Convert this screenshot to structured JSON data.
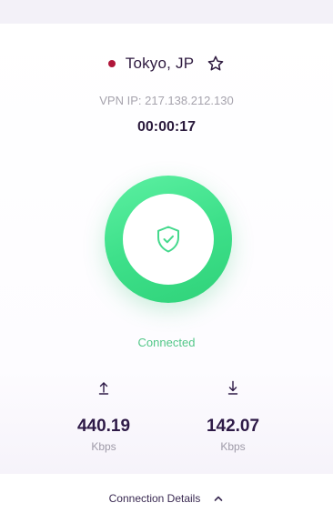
{
  "location": {
    "name": "Tokyo, JP",
    "status_dot_color": "#b0163a"
  },
  "connection": {
    "vpn_ip": "VPN IP: 217.138.212.130",
    "timer": "00:00:17",
    "status": "Connected",
    "status_color": "#52c788",
    "toggle_color": "#3ee08a"
  },
  "stats": {
    "upload": {
      "icon": "upload-arrow-icon",
      "value": "440.19",
      "unit": "Kbps"
    },
    "download": {
      "icon": "download-arrow-icon",
      "value": "142.07",
      "unit": "Kbps"
    }
  },
  "footer": {
    "label": "Connection Details",
    "icon": "chevron-up-icon"
  },
  "icons": {
    "favorite": "star-outline-icon",
    "shield": "shield-check-icon"
  }
}
